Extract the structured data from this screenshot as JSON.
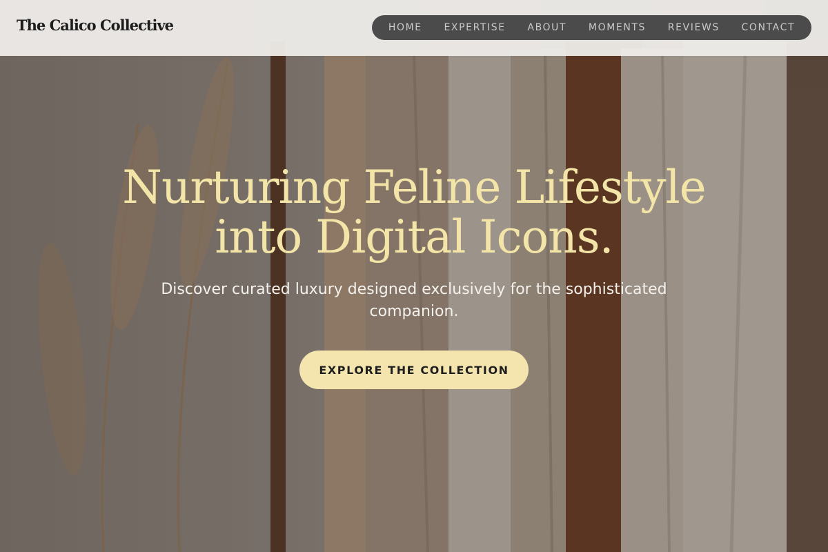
{
  "header": {
    "brand": "The Calico Collective",
    "nav": [
      {
        "label": "HOME"
      },
      {
        "label": "EXPERTISE"
      },
      {
        "label": "ABOUT"
      },
      {
        "label": "MOMENTS"
      },
      {
        "label": "REVIEWS"
      },
      {
        "label": "CONTACT"
      }
    ]
  },
  "hero": {
    "title_line1": "Nurturing Feline Lifestyle",
    "title_line2": "into Digital Icons.",
    "subtitle": "Discover curated luxury designed exclusively for the sophisticated companion.",
    "cta_label": "EXPLORE THE COLLECTION"
  },
  "colors": {
    "accent": "#f3e4a8",
    "cta_bg": "#f4e5ae",
    "nav_bg": "#4b4b4b",
    "header_bg": "#eeece9"
  }
}
